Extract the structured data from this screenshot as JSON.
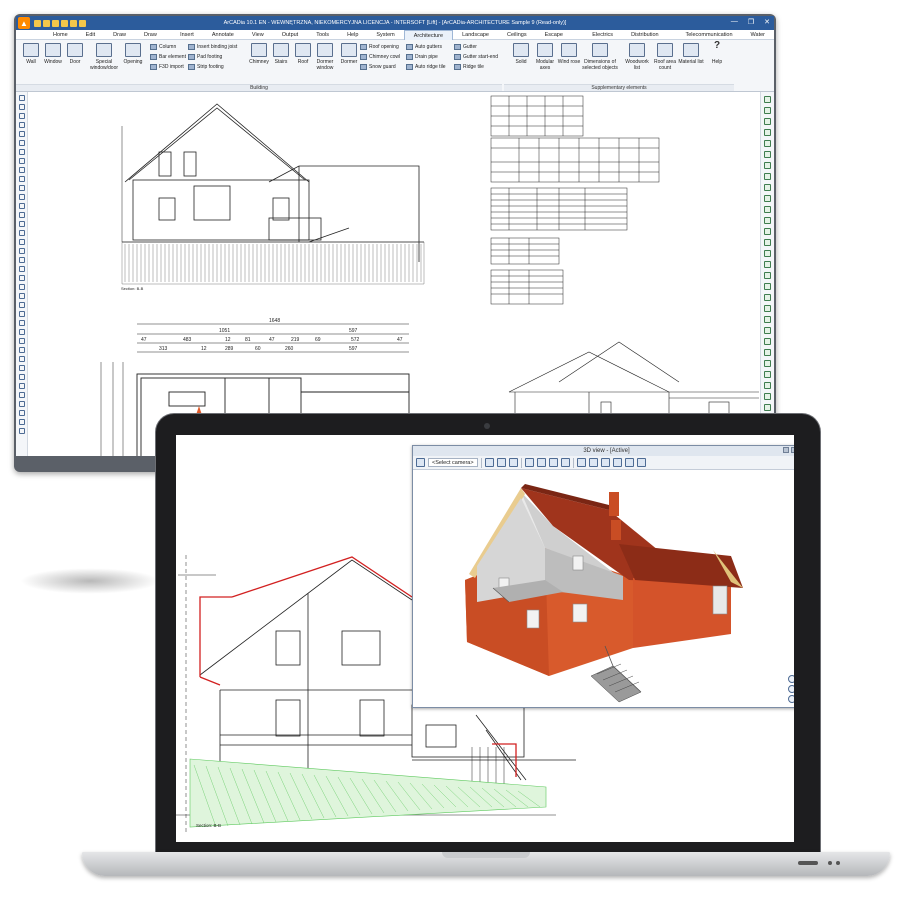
{
  "app": {
    "title": "ArCADia 10.1 EN - WEWNĘTRZNA, NIEKOMERCYJNA LICENCJA - INTERSOFT [Lift] - [ArCADia-ARCHITECTURE Sample 9 (Read-only)]",
    "logo_icon": "arcadia-logo-icon",
    "window_buttons": [
      "—",
      "❐",
      "✕"
    ]
  },
  "menu": {
    "tabs": [
      "Home",
      "Edit",
      "Draw",
      "Draw 3D",
      "Insert",
      "Annotate",
      "View",
      "Output",
      "Tools",
      "Help",
      "System",
      "Architecture",
      "Landscape",
      "Ceilings",
      "Escape routes",
      "Electrics",
      "Distribution board",
      "Telecommunication",
      "Water"
    ],
    "active": "Architecture"
  },
  "ribbon": {
    "building": {
      "group_label": "Building",
      "large_buttons": [
        "Wall",
        "Window",
        "Door",
        "Special window/door",
        "Opening"
      ],
      "small_col1": [
        "Column",
        "Bar element",
        "F3D import"
      ],
      "small_col2": [
        "Insert binding joist",
        "Pad footing",
        "Strip footing"
      ],
      "large_buttons2": [
        "Chimney",
        "Stairs",
        "Roof",
        "Dormer window",
        "Dormer"
      ],
      "small_col3": [
        "Roof opening",
        "Chimney cowl",
        "Snow guard"
      ],
      "small_col4": [
        "Auto gutters",
        "Drain pipe",
        "Auto ridge tile"
      ],
      "small_col5": [
        "Gutter",
        "Gutter start-end",
        "Ridge tile"
      ]
    },
    "supplementary": {
      "group_label": "Supplementary elements",
      "buttons": [
        "Solid",
        "Modular axes",
        "Wind rose",
        "Dimensions of selected objects",
        "Woodwork list",
        "Roof area count",
        "Material list",
        "Help"
      ]
    }
  },
  "drawing": {
    "dimensions_top": [
      "1648",
      "1051",
      "597"
    ],
    "dimensions_mid": [
      "47",
      "483",
      "12",
      "81",
      "47",
      "219",
      "69",
      "572",
      "47"
    ],
    "dimensions_low": [
      "313",
      "12",
      "289",
      "60",
      "260",
      "597"
    ],
    "section_label": "Section: B-B"
  },
  "view3d": {
    "title": "3D view - [Active]",
    "camera_select": "<Select camera>"
  },
  "laptop_drawing": {
    "section_label": "Section: B-B"
  },
  "colors": {
    "titlebar": "#2c5c9c",
    "roof": "#a0341c",
    "brick": "#d6552a",
    "hatch_green": "#5ec95e",
    "section_red": "#d22020"
  }
}
